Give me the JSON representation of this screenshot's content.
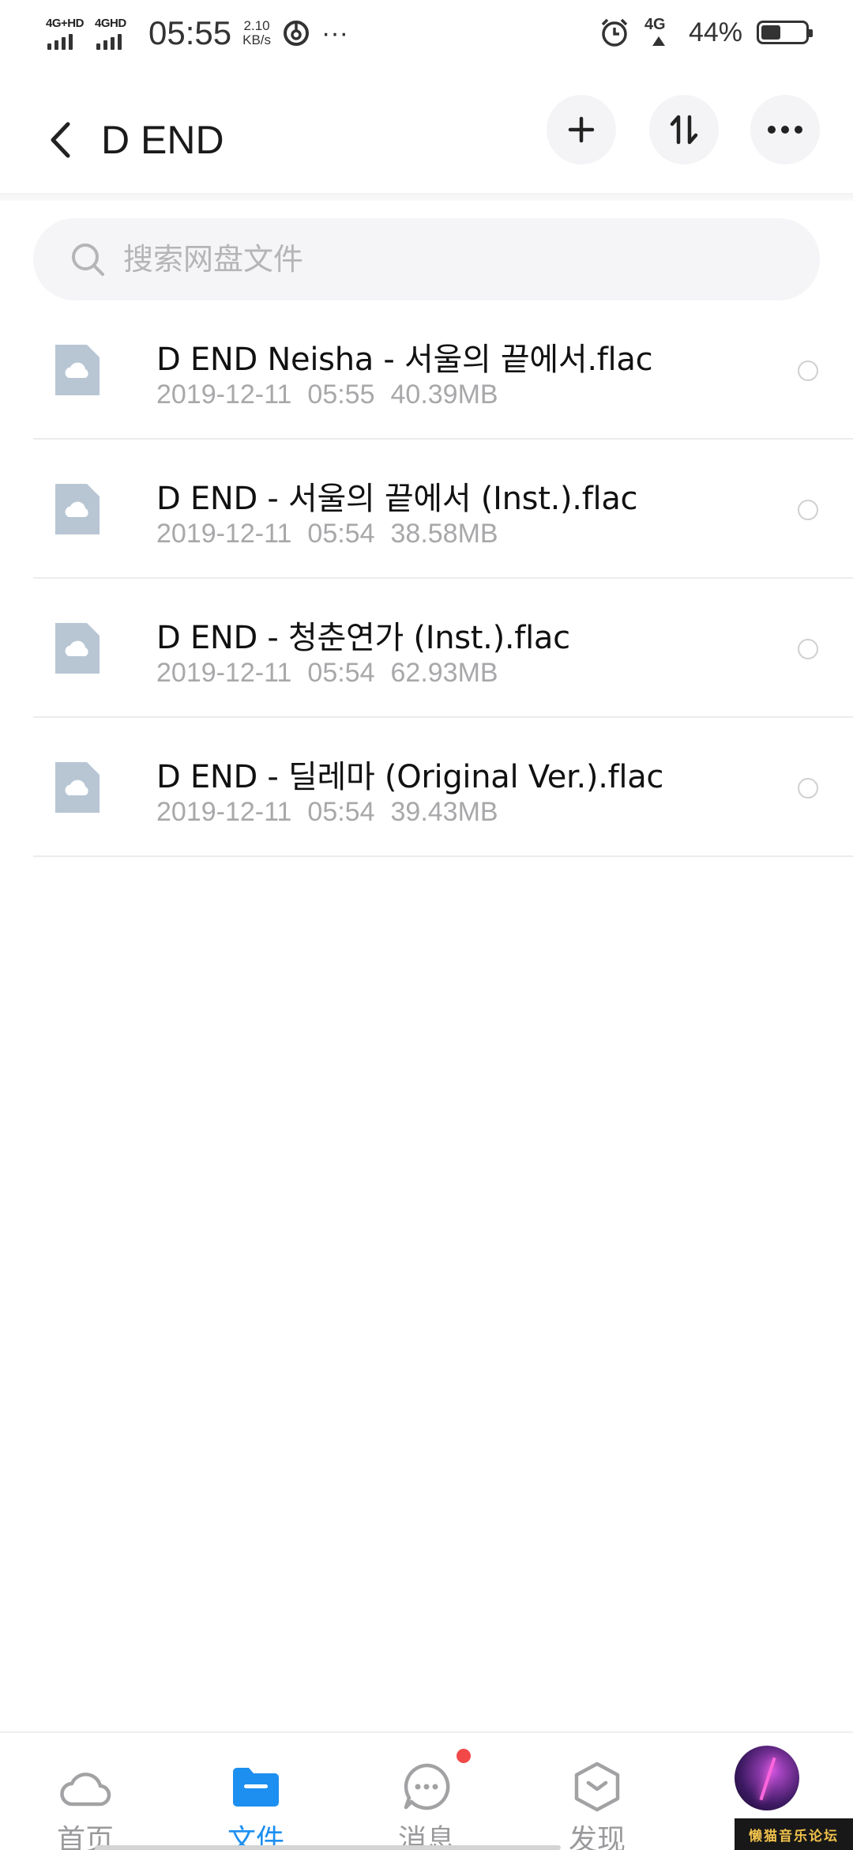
{
  "status_bar": {
    "signal1_label": "4G+HD",
    "signal2_label": "4GHD",
    "time": "05:55",
    "speed_value": "2.10",
    "speed_unit": "KB/s",
    "more": "···",
    "network_label": "4G",
    "battery_percent": "44%",
    "battery_level": 0.44
  },
  "header": {
    "title": "D END"
  },
  "search": {
    "placeholder": "搜索网盘文件",
    "value": ""
  },
  "files": [
    {
      "name": "D END Neisha - 서울의 끝에서.flac",
      "date": "2019-12-11",
      "time": "05:55",
      "size": "40.39MB"
    },
    {
      "name": "D END - 서울의 끝에서 (Inst.).flac",
      "date": "2019-12-11",
      "time": "05:54",
      "size": "38.58MB"
    },
    {
      "name": "D END - 청춘연가 (Inst.).flac",
      "date": "2019-12-11",
      "time": "05:54",
      "size": "62.93MB"
    },
    {
      "name": "D END - 딜레마 (Original Ver.).flac",
      "date": "2019-12-11",
      "time": "05:54",
      "size": "39.43MB"
    }
  ],
  "nav": {
    "items": [
      {
        "label": "首页",
        "icon": "cloud-icon",
        "active": false
      },
      {
        "label": "文件",
        "icon": "folder-icon",
        "active": true
      },
      {
        "label": "消息",
        "icon": "chat-icon",
        "active": false
      },
      {
        "label": "发现",
        "icon": "discover-icon",
        "active": false
      }
    ]
  },
  "watermark": "懒猫音乐论坛",
  "colors": {
    "accent": "#1d8ff0",
    "badge": "#f24848",
    "file_icon": "#b8c6d4"
  }
}
